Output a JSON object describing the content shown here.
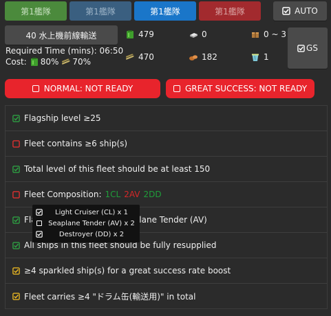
{
  "tabs": [
    {
      "label": "第1艦隊"
    },
    {
      "label": "第1艦隊"
    },
    {
      "label": "第1艦隊"
    },
    {
      "label": "第1艦隊"
    }
  ],
  "auto_button": {
    "label": "AUTO",
    "icon": "checkbox-icon"
  },
  "mission": {
    "label": "40 水上機前線輸送"
  },
  "required_time": "Required Time (mins): 06:50",
  "cost": {
    "prefix": "Cost:",
    "fuel": "80%",
    "ammo": "70%"
  },
  "resources": {
    "fuel": "479",
    "ammo": "470",
    "steel": "0",
    "bauxite": "182",
    "box": "0 ~ 3",
    "bucket": "1"
  },
  "gs_button": {
    "label": "GS",
    "icon": "checkbox-icon"
  },
  "status": {
    "normal": "NORMAL: NOT READY",
    "great_success": "GREAT SUCCESS: NOT READY",
    "color": "#e8242c"
  },
  "conditions": [
    {
      "text": "Flagship level ≥25",
      "state": "ok"
    },
    {
      "text": "Fleet contains ≥6 ship(s)",
      "state": "fail"
    },
    {
      "text": "Total level of this fleet should be at least 150",
      "state": "ok"
    },
    {
      "text": "Fleet Composition:",
      "state": "fail",
      "tags": [
        {
          "text": "1CL",
          "color": "#1f9e3a"
        },
        {
          "text": "2AV",
          "color": "#d62828"
        },
        {
          "text": "2DD",
          "color": "#1f9e3a"
        }
      ]
    },
    {
      "text": "Flagship type must be Seaplane Tender (AV)",
      "state": "ok"
    },
    {
      "text": "All ships in this fleet should be fully resupplied",
      "state": "ok"
    },
    {
      "text": "≥4 sparkled ship(s) for a great success rate boost",
      "state": "gs"
    },
    {
      "text": "Fleet carries ≥4 \"ドラム缶(輸送用)\" in total",
      "state": "gs"
    }
  ],
  "tooltip": [
    {
      "label": "Light Cruiser (CL) x 1",
      "checked": true
    },
    {
      "label": "Seaplane Tender (AV) x 2",
      "checked": false
    },
    {
      "label": "Destroyer (DD) x 2",
      "checked": true
    }
  ],
  "colors": {
    "ok": "#2ea043",
    "fail": "#e03030",
    "gs": "#e6b422",
    "background": "#2b2b2b"
  }
}
